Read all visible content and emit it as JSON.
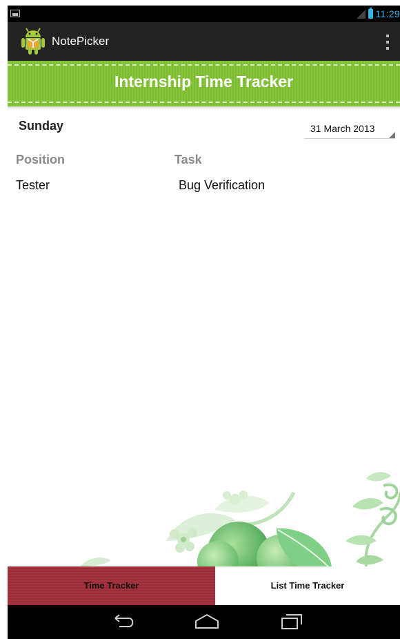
{
  "status_bar": {
    "time": "11:29",
    "icons": [
      "gallery-notification-icon",
      "signal-icon",
      "battery-icon"
    ],
    "clock_color": "#33b5e5"
  },
  "action_bar": {
    "app_title": "NotePicker",
    "app_icon": "android-app-icon",
    "menu_icon": "overflow-menu-icon"
  },
  "banner": {
    "title": "Internship Time Tracker",
    "color": "#86c43c"
  },
  "entry": {
    "day": "Sunday",
    "date": "31 March 2013"
  },
  "table": {
    "columns": [
      "Position",
      "Task"
    ],
    "rows": [
      [
        "Tester",
        "Bug Verification"
      ]
    ]
  },
  "tabs": [
    {
      "label": "Time Tracker",
      "selected": true,
      "color": "#9c2d36"
    },
    {
      "label": "List Time Tracker",
      "selected": false,
      "color": "#ffffff"
    }
  ],
  "nav_bar": {
    "icons": [
      "back-icon",
      "home-icon",
      "recents-icon"
    ]
  }
}
